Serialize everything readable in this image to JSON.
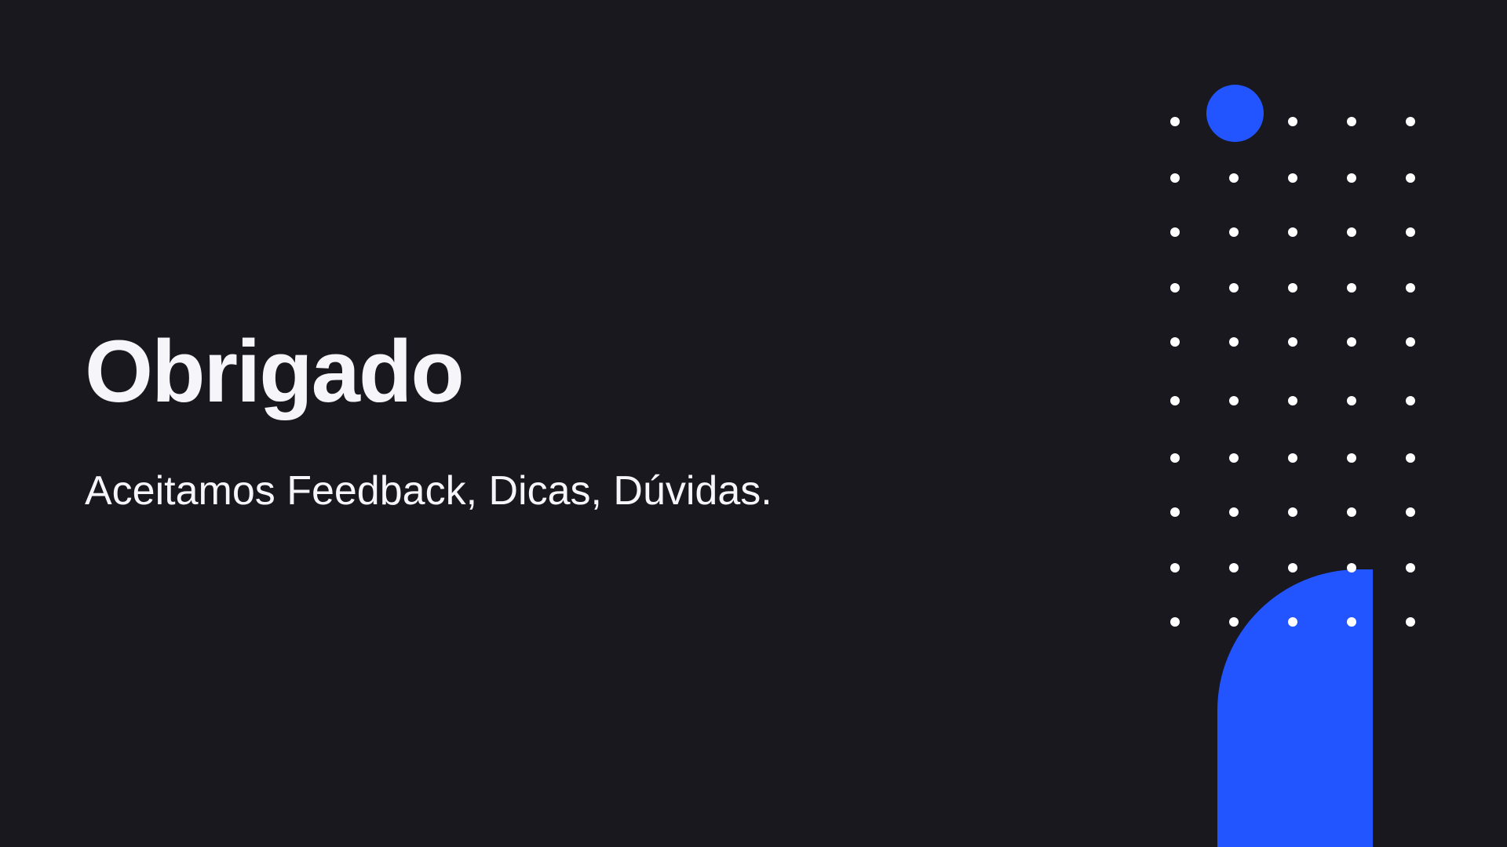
{
  "slide": {
    "title": "Obrigado",
    "subtitle": "Aceitamos Feedback, Dicas, Dúvidas."
  },
  "colors": {
    "background": "#18181e",
    "text": "#f5f5fa",
    "accent": "#2255ff",
    "dot": "#ffffff"
  },
  "decor": {
    "pattern": "dot-grid",
    "dot_rows": 10,
    "dot_cols": 5,
    "shapes": [
      "accent-circle",
      "accent-arch"
    ]
  }
}
